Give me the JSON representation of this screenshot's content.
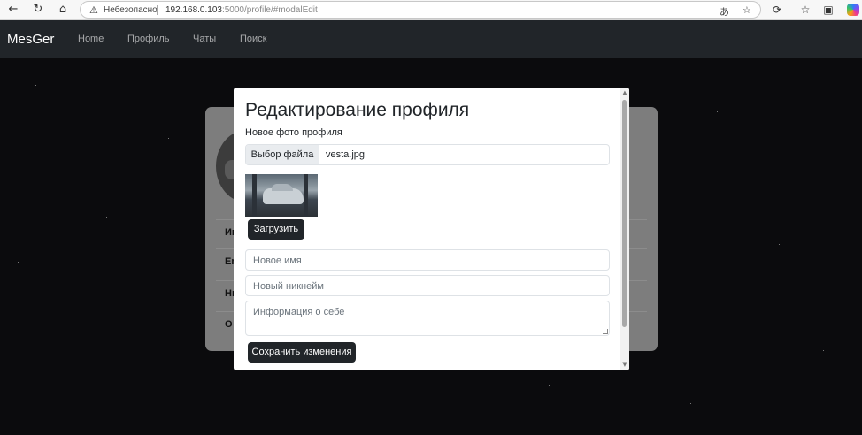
{
  "browser": {
    "insecure_label": "Небезопасно",
    "url_host": "192.168.0.103",
    "url_rest": ":5000/profile/#modalEdit",
    "icons": [
      "back-icon",
      "reload-icon",
      "home-icon",
      "warning-icon",
      "read-aloud-icon",
      "favorite-star-icon",
      "extensions-icon",
      "favorites-icon",
      "collections-icon",
      "copilot-icon"
    ]
  },
  "navbar": {
    "brand": "MesGer",
    "links": [
      "Home",
      "Профиль",
      "Чаты",
      "Поиск"
    ]
  },
  "profile_card": {
    "row_labels": [
      "Им",
      "Em",
      "Ни",
      "О"
    ]
  },
  "modal": {
    "title": "Редактирование профиля",
    "photo_label": "Новое фото профиля",
    "file_button": "Выбор файла",
    "file_name": "vesta.jpg",
    "upload_button": "Загрузить",
    "name_placeholder": "Новое имя",
    "nickname_placeholder": "Новый никнейм",
    "about_placeholder": "Информация о себе",
    "save_button": "Сохранить изменения"
  },
  "colors": {
    "navbar": "#212529",
    "button_dark": "#212529",
    "backdrop": "#0b0b0d"
  }
}
